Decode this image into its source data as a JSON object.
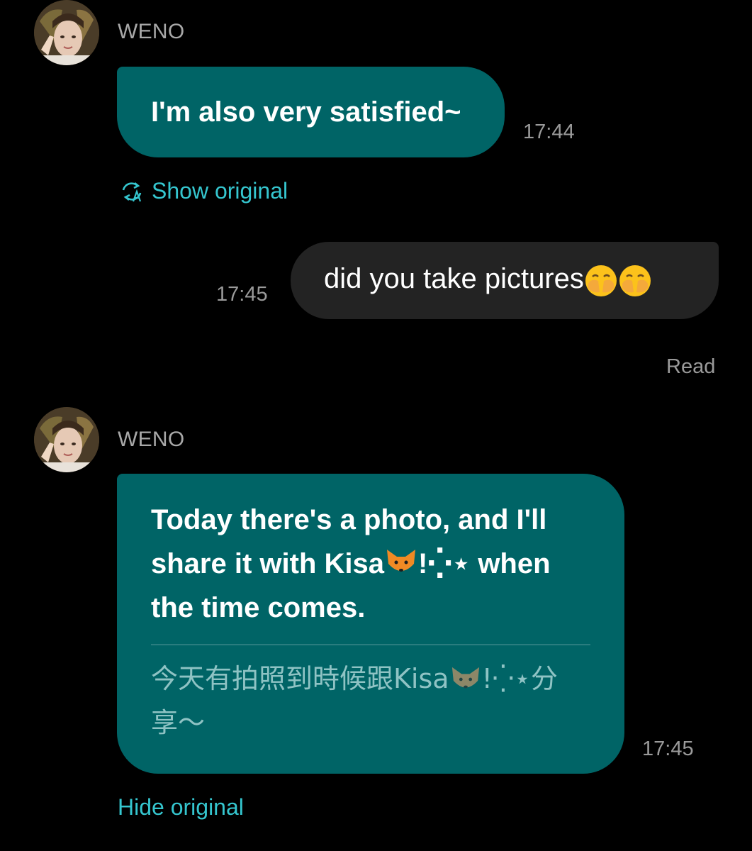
{
  "messages": [
    {
      "sender": "WENO",
      "text": "I'm also very satisfied~",
      "time": "17:44",
      "action": "Show original"
    },
    {
      "text": "did you take pictures",
      "emoji": [
        "hand-over-mouth-face-emoji",
        "hand-over-mouth-face-emoji"
      ],
      "time": "17:45",
      "status": "Read"
    },
    {
      "sender": "WENO",
      "translated_lines": [
        "Today there's a photo, and I'll",
        "share it with Kisa",
        "!⁛⋆ when",
        "the time comes."
      ],
      "original_lines": [
        "今天有拍照到時候跟Kisa",
        "!⁛⋆分",
        "享～"
      ],
      "time": "17:45",
      "action": "Hide original"
    }
  ],
  "colors": {
    "background": "#000000",
    "incoming_bubble": "#006466",
    "outgoing_bubble": "#232323",
    "link": "#35c6cf",
    "muted_text": "#9a9a9a"
  }
}
